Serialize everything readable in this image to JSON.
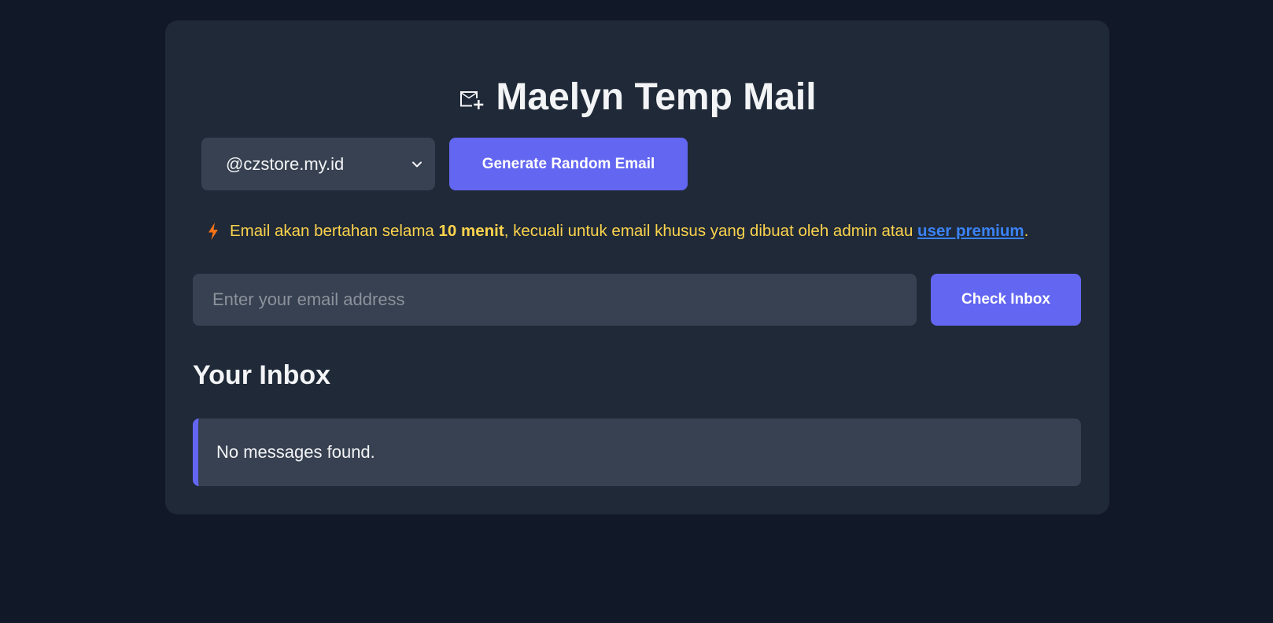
{
  "header": {
    "icon": "mail-plus-icon",
    "title": "Maelyn Temp Mail"
  },
  "generator": {
    "selected_domain": "@czstore.my.id",
    "generate_label": "Generate Random Email"
  },
  "notice": {
    "icon": "lightning-bolt-icon",
    "text_before": "Email akan bertahan selama ",
    "duration": "10 menit",
    "text_middle": ", kecuali untuk email khusus yang dibuat oleh admin atau ",
    "link_text": "user premium",
    "text_after": "."
  },
  "check": {
    "placeholder": "Enter your email address",
    "value": "",
    "button_label": "Check Inbox"
  },
  "inbox": {
    "title": "Your Inbox",
    "empty_message": "No messages found."
  },
  "colors": {
    "background": "#111827",
    "card": "#1f2937",
    "field": "#374151",
    "accent": "#6366f1",
    "notice": "#fcd34d",
    "link": "#3b82f6",
    "bolt": "#f97316"
  }
}
